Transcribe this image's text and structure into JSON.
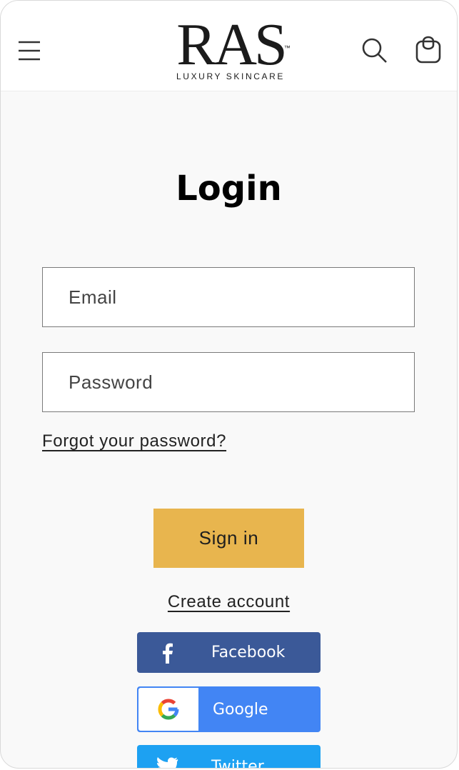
{
  "header": {
    "logo_text": "RAS",
    "logo_tm": "™",
    "logo_tagline": "LUXURY SKINCARE",
    "icons": [
      "menu-icon",
      "search-icon",
      "cart-icon"
    ]
  },
  "login": {
    "title": "Login",
    "email_placeholder": "Email",
    "email_value": "",
    "password_placeholder": "Password",
    "password_value": "",
    "forgot_label": "Forgot your password?",
    "signin_label": "Sign in",
    "create_label": "Create account"
  },
  "social": {
    "facebook_label": "Facebook",
    "google_label": "Google",
    "twitter_label": "Twitter"
  },
  "colors": {
    "accent": "#e8b54e",
    "facebook": "#3b5998",
    "google": "#4285f4",
    "twitter": "#1da1f2"
  }
}
